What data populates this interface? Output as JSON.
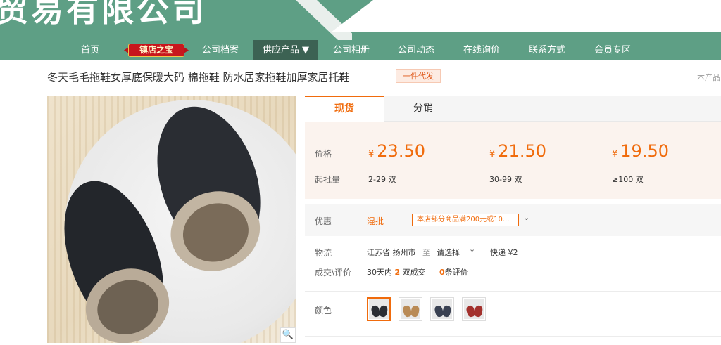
{
  "banner": {
    "company_name": "贸易有限公司"
  },
  "nav": {
    "items": [
      "首页",
      "公司档案",
      "供应产品 ▼",
      "公司相册",
      "公司动态",
      "在线询价",
      "联系方式",
      "会员专区"
    ],
    "badge": "镇店之宝",
    "active": "供应产品 ▼"
  },
  "product": {
    "title": "冬天毛毛拖鞋女厚底保暖大码 棉拖鞋 防水居家拖鞋加厚家居托鞋",
    "dropship_tag": "一件代发",
    "right_note": "本产品"
  },
  "tabs": {
    "spot": "现货",
    "distribution": "分销"
  },
  "pricing": {
    "price_label": "价格",
    "moq_label": "起批量",
    "currency": "¥",
    "tiers": [
      {
        "price": "23.50",
        "range": "2-29 双"
      },
      {
        "price": "21.50",
        "range": "30-99 双"
      },
      {
        "price": "19.50",
        "range": "≥100 双"
      }
    ]
  },
  "discount": {
    "label": "优惠",
    "mix": "混批",
    "coupon": "本店部分商品满200元或10...",
    "dropdown": "⌄"
  },
  "logistics": {
    "label": "物流",
    "origin": "江苏省 扬州市",
    "to": "至",
    "select": "请选择",
    "select_arrow": "⌄",
    "shipping": "快递 ¥2"
  },
  "transactions": {
    "label": "成交\\评价",
    "prefix": "30天内",
    "count": "2",
    "count_suffix": "双成交",
    "reviews": "0",
    "reviews_suffix": "条评价"
  },
  "color": {
    "label": "颜色"
  },
  "colors": {
    "accent": "#f06b0c",
    "nav_green": "#5e9f85",
    "nav_active": "#3c6253"
  }
}
